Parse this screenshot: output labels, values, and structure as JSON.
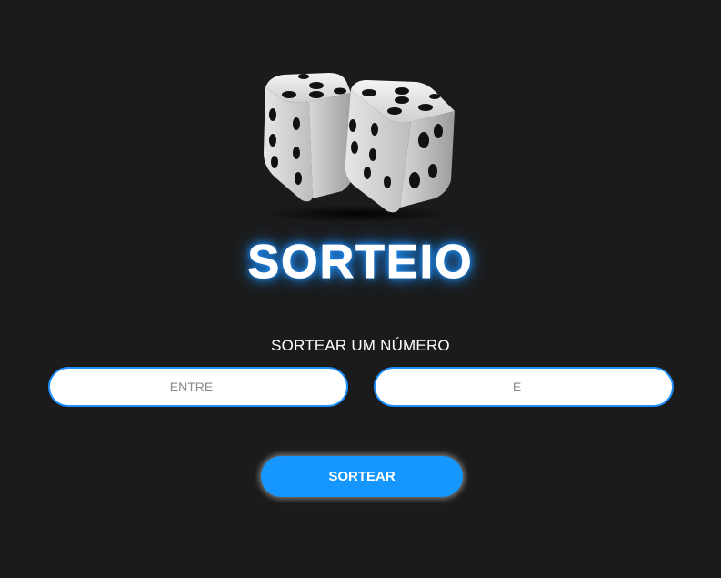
{
  "header": {
    "title": "SORTEIO",
    "logo_icon": "dice-icon"
  },
  "form": {
    "subtitle": "SORTEAR UM NÚMERO",
    "min_field": {
      "placeholder": "ENTRE",
      "value": ""
    },
    "max_field": {
      "placeholder": "E",
      "value": ""
    },
    "submit_label": "SORTEAR"
  },
  "colors": {
    "background": "#1b1b1b",
    "accent": "#1597ff",
    "title_glow": "#1e90ff",
    "text": "#ffffff"
  }
}
